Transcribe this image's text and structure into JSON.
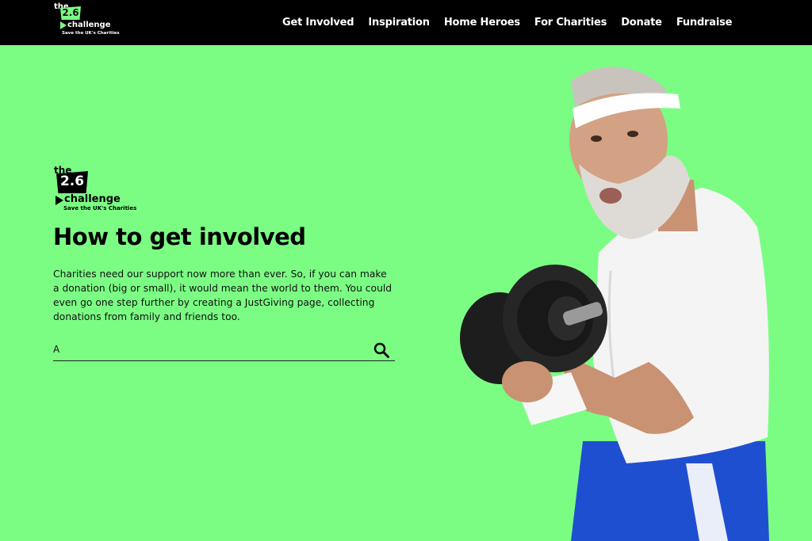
{
  "brand": {
    "the": "the",
    "number": "2.6",
    "word": "challenge",
    "tagline": "Save the UK's Charities"
  },
  "nav": {
    "items": [
      {
        "label": "Get Involved"
      },
      {
        "label": "Inspiration"
      },
      {
        "label": "Home Heroes"
      },
      {
        "label": "For Charities"
      },
      {
        "label": "Donate"
      },
      {
        "label": "Fundraise"
      }
    ]
  },
  "main": {
    "title": "How to get involved",
    "intro": "Charities need our support now more than ever. So, if you can make a donation (big or small), it would mean the world to them. You could even go one step further by creating a JustGiving page, collecting donations from family and friends too.",
    "search": {
      "placeholder": "A",
      "icon": "search-icon"
    }
  },
  "colors": {
    "background": "#7bfd84",
    "topbar": "#000000",
    "accent": "#7bfd84"
  },
  "hero": {
    "icon": "man-lifting-dumbbell-photo"
  }
}
